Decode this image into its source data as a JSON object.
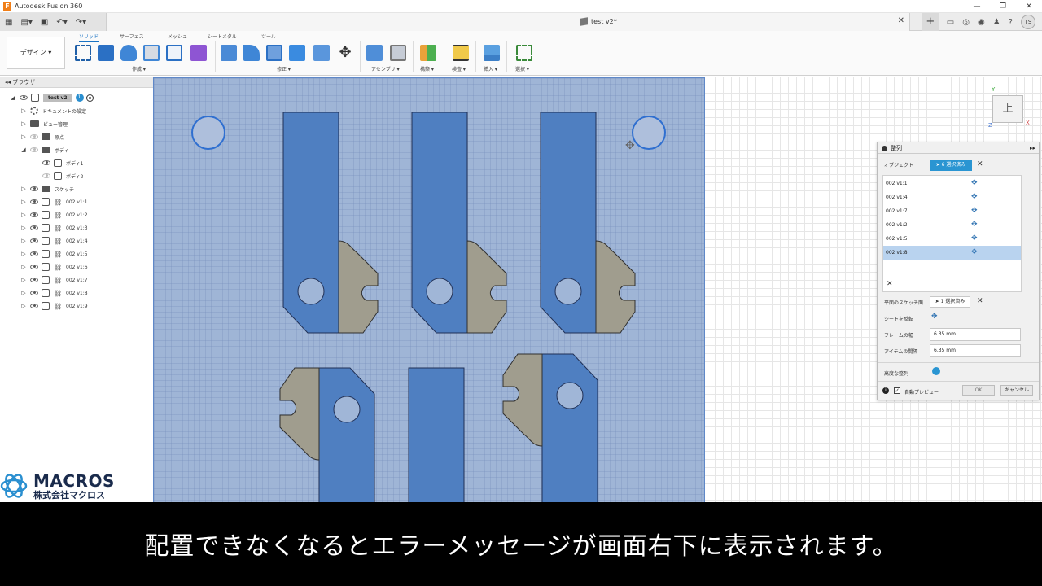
{
  "window": {
    "title": "Autodesk Fusion 360",
    "logo_letter": "F"
  },
  "document": {
    "tab_name": "test v2*"
  },
  "user": {
    "initials": "TS"
  },
  "ribbon": {
    "workspace": "デザイン ▾",
    "tabs": [
      "ソリッド",
      "サーフェス",
      "メッシュ",
      "シートメタル",
      "ツール"
    ],
    "groups": [
      "作成 ▾",
      "修正 ▾",
      "アセンブリ ▾",
      "構築 ▾",
      "検査 ▾",
      "挿入 ▾",
      "選択 ▾"
    ]
  },
  "browser": {
    "title": "ブラウザ",
    "root": "test v2",
    "root_badge": "1",
    "items": [
      "ドキュメントの設定",
      "ビュー管理",
      "原点",
      "ボディ",
      "ボディ1",
      "ボディ2",
      "スケッチ",
      "002 v1:1",
      "002 v1:2",
      "002 v1:3",
      "002 v1:4",
      "002 v1:5",
      "002 v1:6",
      "002 v1:7",
      "002 v1:8",
      "002 v1:9"
    ]
  },
  "viewcube": {
    "face": "上",
    "axis_y": "Y",
    "axis_z": "Z",
    "axis_x": "X"
  },
  "dialog": {
    "title": "整列",
    "object_label": "オブジェクト",
    "object_selected": "6 選択済み",
    "objects": [
      "002 v1:1",
      "002 v1:4",
      "002 v1:7",
      "002 v1:2",
      "002 v1:5",
      "002 v1:8"
    ],
    "sketch_label": "平面のスケッチ面",
    "sketch_selected": "1 選択済み",
    "flip_label": "シートを反転",
    "frame_label": "フレームの幅",
    "frame_value": "6.35 mm",
    "spacing_label": "アイテムの間隔",
    "spacing_value": "6.35 mm",
    "advanced_label": "高度な整列",
    "preview_label": "自動プレビュー",
    "ok": "OK",
    "cancel": "キャンセル",
    "info": "i",
    "check": "✓",
    "close": "✕"
  },
  "watermark": {
    "name": "MACROS",
    "sub": "株式会社マクロス"
  },
  "subtitle": "配置できなくなるとエラーメッセージが画面右下に表示されます。",
  "colors": {
    "sheet": "#9fb5d6",
    "part_blue": "#4f7fc1",
    "part_gray": "#a09d8e",
    "selection": "#2a95d2"
  }
}
